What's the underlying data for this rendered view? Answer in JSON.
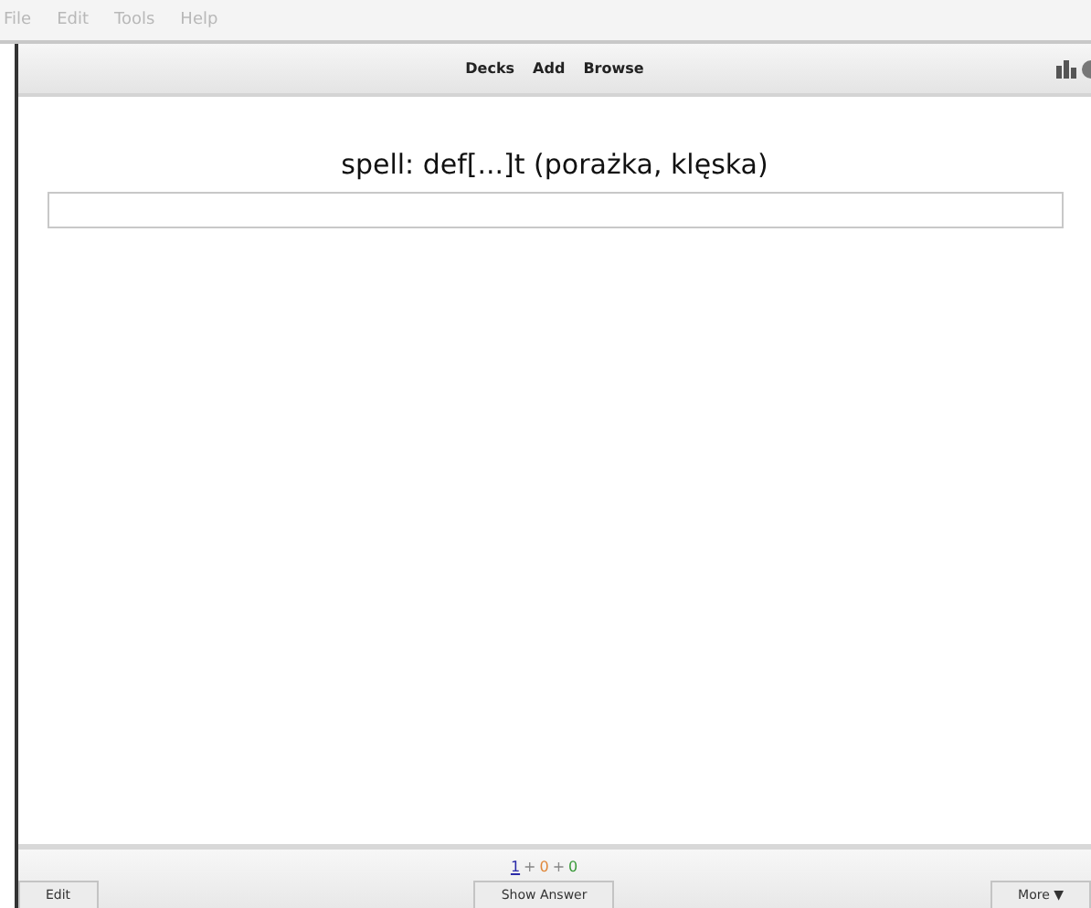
{
  "menu": [
    "File",
    "Edit",
    "Tools",
    "Help"
  ],
  "toolbar": {
    "links": [
      "Decks",
      "Add",
      "Browse"
    ]
  },
  "card": {
    "question": "spell: def[...]t (porażka, klęska)"
  },
  "counts": [
    {
      "text": "1",
      "color": "#2a2aa8",
      "underlined": true
    },
    {
      "text": "+",
      "color": "#888888",
      "underlined": false
    },
    {
      "text": "0",
      "color": "#e0873a",
      "underlined": false
    },
    {
      "text": "+",
      "color": "#888888",
      "underlined": false
    },
    {
      "text": "0",
      "color": "#3a9a3a",
      "underlined": false
    }
  ],
  "buttons": {
    "edit": "Edit",
    "show_answer": "Show Answer",
    "more": "More ▼"
  }
}
